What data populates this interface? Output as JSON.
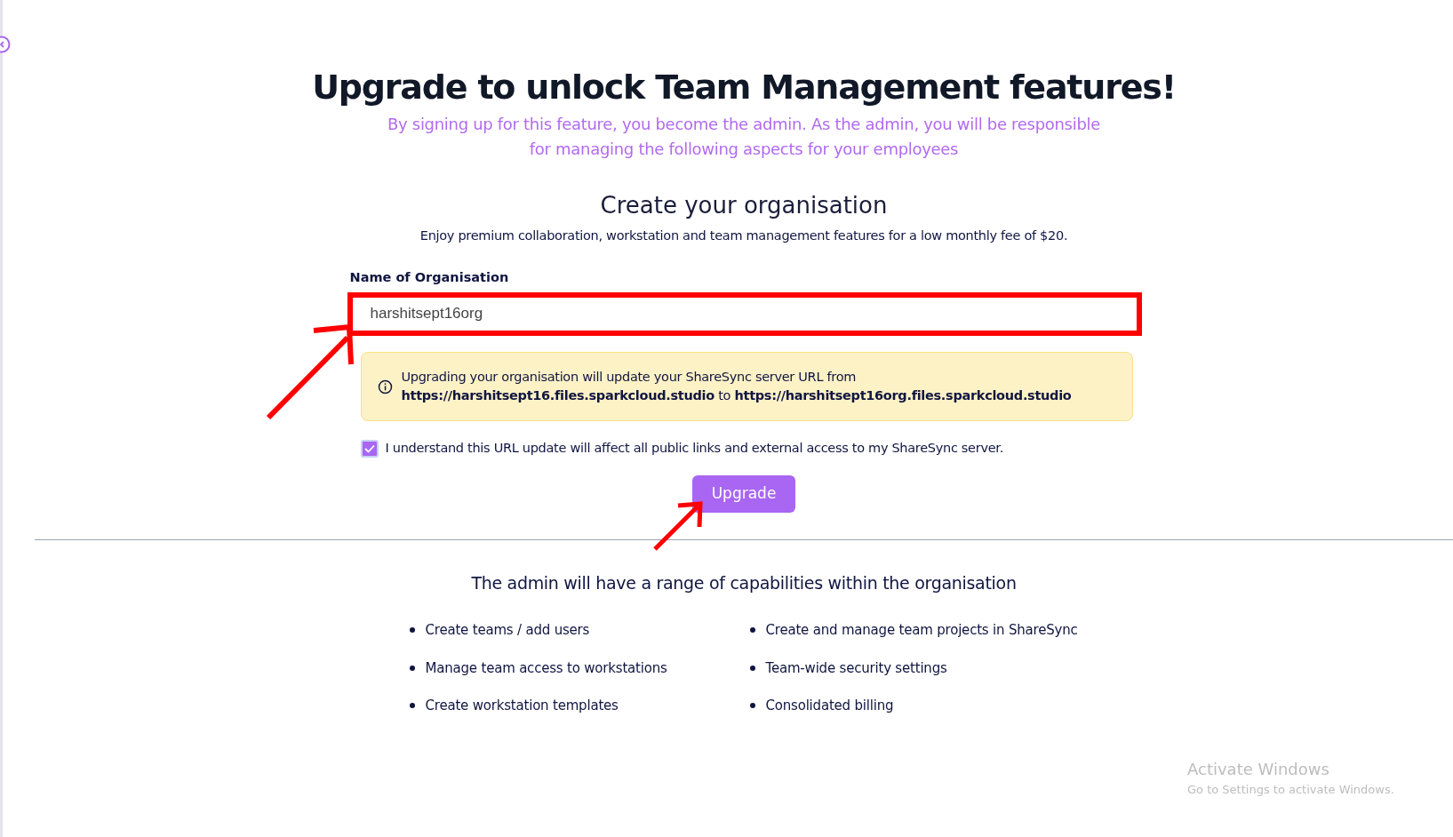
{
  "title": "Upgrade to unlock Team Management features!",
  "subtitle": "By signing up for this feature, you become the admin. As the admin, you will be responsible for managing the following aspects for your employees",
  "form": {
    "heading": "Create your organisation",
    "description": "Enjoy premium collaboration, workstation and team management features for a low monthly fee of $20.",
    "field_label": "Name of Organisation",
    "field_value": "harshitsept16org",
    "notice": {
      "text": "Upgrading your organisation will update your ShareSync server URL from",
      "old_url": "https://harshitsept16.files.sparkcloud.studio",
      "joiner": "to",
      "new_url": "https://harshitsept16org.files.sparkcloud.studio"
    },
    "consent": {
      "label": "I understand this URL update will affect all public links and external access to my ShareSync server.",
      "checked": true
    },
    "button": "Upgrade"
  },
  "capabilities": {
    "heading": "The admin will have a range of capabilities within the organisation",
    "items": [
      "Create teams / add users",
      "Create and manage team projects in ShareSync",
      "Manage team access to workstations",
      "Team-wide security settings",
      "Create workstation templates",
      "Consolidated billing"
    ]
  },
  "os_notice": {
    "title": "Activate Windows",
    "text": "Go to Settings to activate Windows."
  }
}
